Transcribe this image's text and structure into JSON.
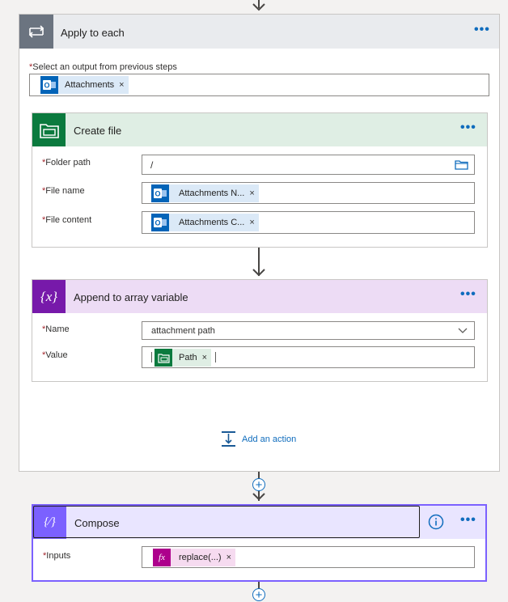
{
  "apply_to_each": {
    "title": "Apply to each",
    "more_label": "•••",
    "select_label": "Select an output from previous steps",
    "select_token": {
      "label": "Attachments",
      "icon": "outlook-icon"
    }
  },
  "create_file": {
    "title": "Create file",
    "more_label": "•••",
    "fields": {
      "folder_path": {
        "label": "Folder path",
        "value": "/"
      },
      "file_name": {
        "label": "File name",
        "token": "Attachments N..."
      },
      "file_content": {
        "label": "File content",
        "token": "Attachments C..."
      }
    }
  },
  "append_to_array": {
    "title": "Append to array variable",
    "more_label": "•••",
    "icon_text": "{x}",
    "fields": {
      "name": {
        "label": "Name",
        "value": "attachment path"
      },
      "value": {
        "label": "Value",
        "token": "Path"
      }
    }
  },
  "add_action": {
    "label": "Add an action"
  },
  "compose": {
    "title": "Compose",
    "more_label": "•••",
    "icon_text": "{∕}",
    "fields": {
      "inputs": {
        "label": "Inputs",
        "token": "replace(...)",
        "token_icon_text": "fx"
      }
    }
  },
  "required_marker": "*",
  "token_close": "×",
  "plus_symbol": "+",
  "colors": {
    "accent": "#0f6cbd",
    "outlook": "#0364b8",
    "sharepoint": "#0b7a3e",
    "variable": "#7719aa",
    "compose": "#7b61ff",
    "expression": "#ad008c",
    "scope_header": "#e9ebee",
    "create_file_header": "#dfeee4",
    "variable_header": "#eddcf5",
    "compose_header": "#e9e5ff"
  }
}
